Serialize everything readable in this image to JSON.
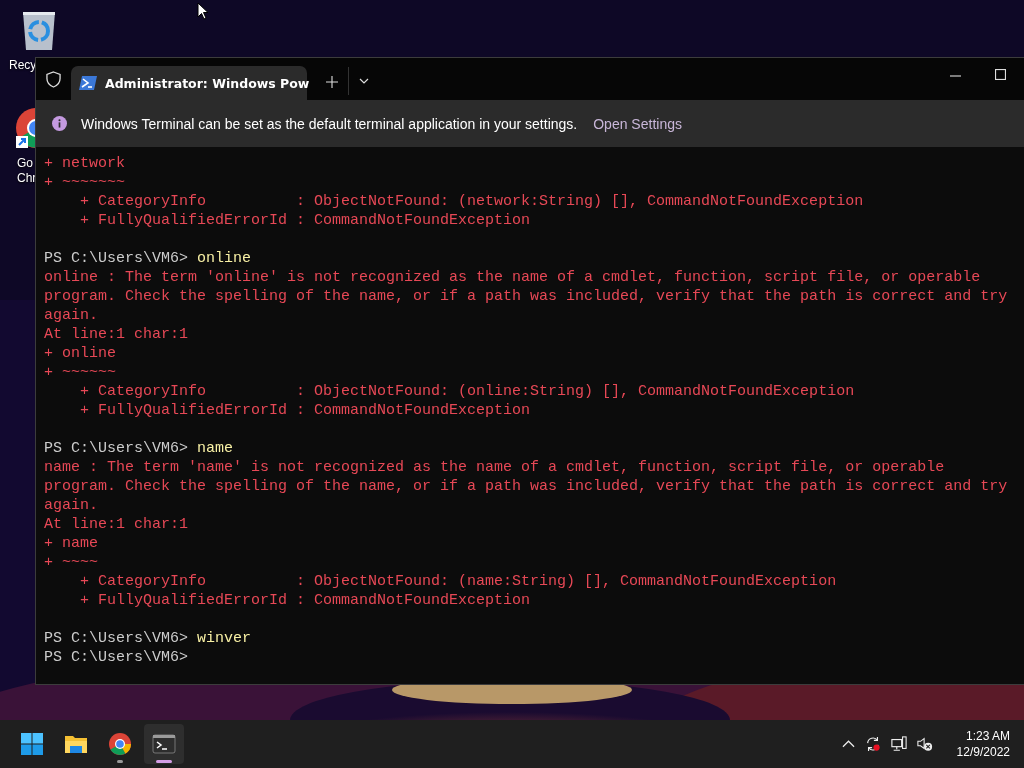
{
  "desktop": {
    "icons": [
      {
        "kind": "recycle-bin",
        "label_lines": [
          "Recy"
        ]
      },
      {
        "kind": "chrome",
        "label_lines": [
          "Go",
          "Chr"
        ]
      }
    ]
  },
  "window": {
    "tab": {
      "title": "Administrator: Windows Pow",
      "selected": true
    },
    "infobar": {
      "message": "Windows Terminal can be set as the default terminal application in your settings.",
      "action": "Open Settings"
    },
    "terminal": {
      "lines": [
        {
          "kind": "error",
          "text": "+ network"
        },
        {
          "kind": "error",
          "text": "+ ~~~~~~~"
        },
        {
          "kind": "error",
          "text": "    + CategoryInfo          : ObjectNotFound: (network:String) [], CommandNotFoundException"
        },
        {
          "kind": "error",
          "text": "    + FullyQualifiedErrorId : CommandNotFoundException"
        },
        {
          "kind": "blank"
        },
        {
          "kind": "prompt",
          "prompt": "PS C:\\Users\\VM6>",
          "command": "online"
        },
        {
          "kind": "error",
          "text": "online : The term 'online' is not recognized as the name of a cmdlet, function, script file, or operable"
        },
        {
          "kind": "error",
          "text": "program. Check the spelling of the name, or if a path was included, verify that the path is correct and try"
        },
        {
          "kind": "error",
          "text": "again."
        },
        {
          "kind": "error",
          "text": "At line:1 char:1"
        },
        {
          "kind": "error",
          "text": "+ online"
        },
        {
          "kind": "error",
          "text": "+ ~~~~~~"
        },
        {
          "kind": "error",
          "text": "    + CategoryInfo          : ObjectNotFound: (online:String) [], CommandNotFoundException"
        },
        {
          "kind": "error",
          "text": "    + FullyQualifiedErrorId : CommandNotFoundException"
        },
        {
          "kind": "blank"
        },
        {
          "kind": "prompt",
          "prompt": "PS C:\\Users\\VM6>",
          "command": "name"
        },
        {
          "kind": "error",
          "text": "name : The term 'name' is not recognized as the name of a cmdlet, function, script file, or operable"
        },
        {
          "kind": "error",
          "text": "program. Check the spelling of the name, or if a path was included, verify that the path is correct and try"
        },
        {
          "kind": "error",
          "text": "again."
        },
        {
          "kind": "error",
          "text": "At line:1 char:1"
        },
        {
          "kind": "error",
          "text": "+ name"
        },
        {
          "kind": "error",
          "text": "+ ~~~~"
        },
        {
          "kind": "error",
          "text": "    + CategoryInfo          : ObjectNotFound: (name:String) [], CommandNotFoundException"
        },
        {
          "kind": "error",
          "text": "    + FullyQualifiedErrorId : CommandNotFoundException"
        },
        {
          "kind": "blank"
        },
        {
          "kind": "prompt",
          "prompt": "PS C:\\Users\\VM6>",
          "command": "winver"
        },
        {
          "kind": "prompt",
          "prompt": "PS C:\\Users\\VM6>"
        }
      ]
    }
  },
  "taskbar": {
    "apps": [
      {
        "kind": "start",
        "running": false,
        "selected": false
      },
      {
        "kind": "explorer",
        "running": false,
        "selected": false
      },
      {
        "kind": "chrome",
        "running": true,
        "selected": false
      },
      {
        "kind": "terminal",
        "running": true,
        "selected": true
      }
    ],
    "tray": [
      {
        "kind": "chevron"
      },
      {
        "kind": "sync"
      },
      {
        "kind": "network"
      },
      {
        "kind": "volume-muted"
      }
    ],
    "clock": {
      "time": "1:23 AM",
      "date": "12/9/2022"
    }
  }
}
